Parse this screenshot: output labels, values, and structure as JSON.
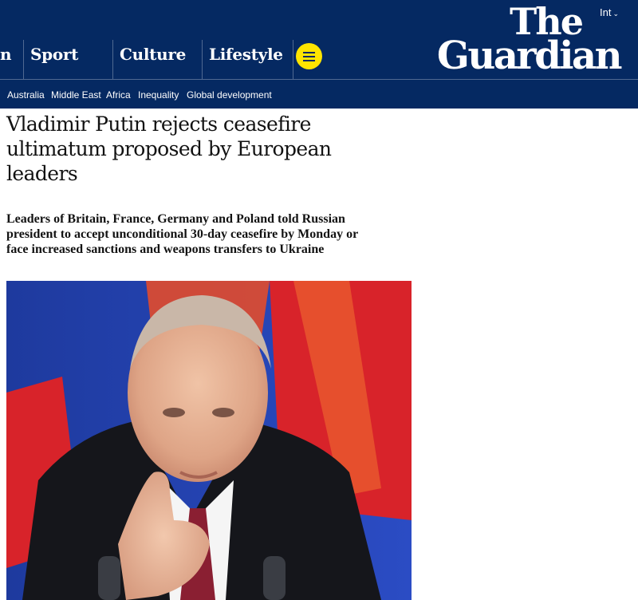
{
  "header": {
    "nav": [
      {
        "label": "n"
      },
      {
        "label": "Sport"
      },
      {
        "label": "Culture"
      },
      {
        "label": "Lifestyle"
      }
    ],
    "menu_icon": "hamburger-menu-icon",
    "edition_label": "Int",
    "edition_icon": "chevron-down-icon",
    "logo": {
      "line1": "The",
      "line2": "Guardian"
    }
  },
  "subnav": {
    "items": [
      "Australia",
      "Middle East",
      "Africa",
      "Inequality",
      "Global development"
    ]
  },
  "article": {
    "headline": "Vladimir Putin rejects ceasefire ultimatum proposed by European leaders",
    "standfirst": "Leaders of Britain, France, Germany and Poland told Russian president to accept unconditional 30-day ceasefire by Monday or face increased sanctions and weapons transfers to Ukraine"
  },
  "colors": {
    "brand_blue": "#052962",
    "menu_yellow": "#ffe500",
    "divider": "#506991",
    "text": "#121212"
  }
}
